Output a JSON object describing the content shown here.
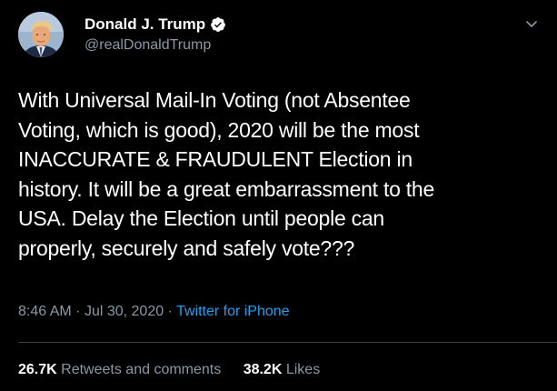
{
  "author": {
    "display_name": "Donald J. Trump",
    "handle": "@realDonaldTrump",
    "verified": true
  },
  "tweet": {
    "text": "With Universal Mail-In Voting (not Absentee\nVoting, which is good), 2020 will be the most\nINACCURATE & FRAUDULENT Election in\nhistory. It will be a great embarrassment to the\nUSA. Delay the Election until people can\nproperly, securely and safely vote???",
    "time": "8:46 AM",
    "separator": "·",
    "date": "Jul 30, 2020",
    "source": "Twitter for iPhone"
  },
  "stats": {
    "retweets_count": "26.7K",
    "retweets_label": "Retweets and comments",
    "likes_count": "38.2K",
    "likes_label": "Likes"
  },
  "colors": {
    "background": "#000000",
    "text_primary": "#ffffff",
    "text_secondary": "#8899a6",
    "link": "#1da1f2",
    "divider": "#38444d"
  },
  "icons": {
    "verified": "verified-badge-icon",
    "more": "chevron-down-icon"
  }
}
